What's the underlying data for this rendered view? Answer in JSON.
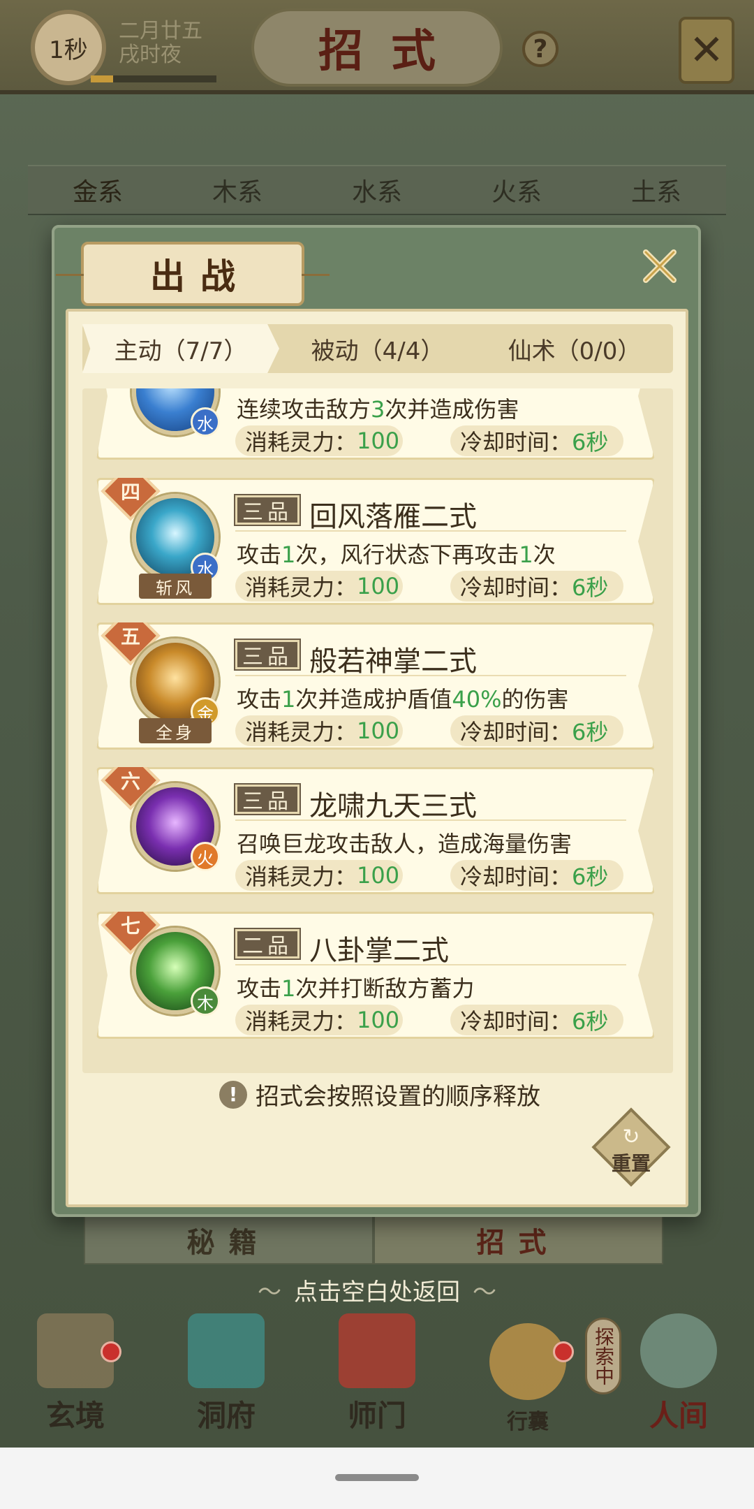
{
  "header": {
    "timer": "1秒",
    "date_line1": "二月廿五",
    "date_line2": "戌时夜",
    "title": "招式",
    "help": "?",
    "close_glyph": "✕"
  },
  "element_tabs": [
    "金系",
    "木系",
    "水系",
    "火系",
    "土系"
  ],
  "bottom_tabs": [
    "秘籍",
    "招式"
  ],
  "return_hint": "点击空白处返回",
  "return_swirl": "〜",
  "bottom_nav": [
    {
      "label": "玄境",
      "icon": "mystic-realm-icon",
      "color": "#8a7a5a",
      "badge": true
    },
    {
      "label": "洞府",
      "icon": "cave-pavilion-icon",
      "color": "#3f8f8a",
      "badge": false
    },
    {
      "label": "师门",
      "icon": "sect-banner-icon",
      "color": "#b8392f",
      "badge": false
    },
    {
      "label": "行囊",
      "icon": "bag-icon",
      "color": "#c99a4a",
      "badge": true
    },
    {
      "label": "人间",
      "icon": "mortal-world-icon",
      "color": "#7a9a8a",
      "badge": false
    }
  ],
  "side_label": "探索中",
  "modal": {
    "title": "出战",
    "tabs": [
      {
        "label": "主动（7/7）",
        "active": true
      },
      {
        "label": "被动（4/4）",
        "active": false
      },
      {
        "label": "仙术（0/0）",
        "active": false
      }
    ],
    "skills": [
      {
        "order": "",
        "grade": "",
        "name": "",
        "icon": "water-burst-icon",
        "icon_color": "#3a7fd0",
        "element": "水",
        "element_color": "#3b6fc7",
        "type_tag": "",
        "desc_parts": [
          {
            "t": "连续攻击敌方"
          },
          {
            "t": "3",
            "hl": true
          },
          {
            "t": "次并造成伤害"
          }
        ],
        "cost_label": "消耗灵力：",
        "cost": "100",
        "cd_label": "冷却时间：",
        "cd": "6秒"
      },
      {
        "order": "四",
        "grade": "三品",
        "name": "回风落雁二式",
        "icon": "wind-blade-icon",
        "icon_color": "#3aa7c9",
        "element": "水",
        "element_color": "#3b6fc7",
        "type_tag": "斩风",
        "desc_parts": [
          {
            "t": "攻击"
          },
          {
            "t": "1",
            "hl": true
          },
          {
            "t": "次，风行状态下再攻击"
          },
          {
            "t": "1",
            "hl": true
          },
          {
            "t": "次"
          }
        ],
        "cost_label": "消耗灵力：",
        "cost": "100",
        "cd_label": "冷却时间：",
        "cd": "6秒"
      },
      {
        "order": "五",
        "grade": "三品",
        "name": "般若神掌二式",
        "icon": "golden-fist-icon",
        "icon_color": "#c98a2a",
        "element": "金",
        "element_color": "#d19a2a",
        "type_tag": "全身",
        "desc_parts": [
          {
            "t": "攻击"
          },
          {
            "t": "1",
            "hl": true
          },
          {
            "t": "次并造成护盾值"
          },
          {
            "t": "40%",
            "hl": true
          },
          {
            "t": "的伤害"
          }
        ],
        "cost_label": "消耗灵力：",
        "cost": "100",
        "cd_label": "冷却时间：",
        "cd": "6秒"
      },
      {
        "order": "六",
        "grade": "三品",
        "name": "龙啸九天三式",
        "icon": "dragon-roar-icon",
        "icon_color": "#7a2fb0",
        "element": "火",
        "element_color": "#e0792a",
        "type_tag": "",
        "desc_parts": [
          {
            "t": "召唤巨龙攻击敌人，造成海量伤害"
          }
        ],
        "cost_label": "消耗灵力：",
        "cost": "100",
        "cd_label": "冷却时间：",
        "cd": "6秒"
      },
      {
        "order": "七",
        "grade": "二品",
        "name": "八卦掌二式",
        "icon": "bagua-palm-icon",
        "icon_color": "#4aa03a",
        "element": "木",
        "element_color": "#4a8a3a",
        "type_tag": "",
        "desc_parts": [
          {
            "t": "攻击"
          },
          {
            "t": "1",
            "hl": true
          },
          {
            "t": "次并打断敌方蓄力"
          }
        ],
        "cost_label": "消耗灵力：",
        "cost": "100",
        "cd_label": "冷却时间：",
        "cd": "6秒"
      }
    ],
    "footer_hint": "招式会按照设置的顺序释放",
    "warn_glyph": "!",
    "reset_label": "重置",
    "reset_glyph": "↻"
  }
}
